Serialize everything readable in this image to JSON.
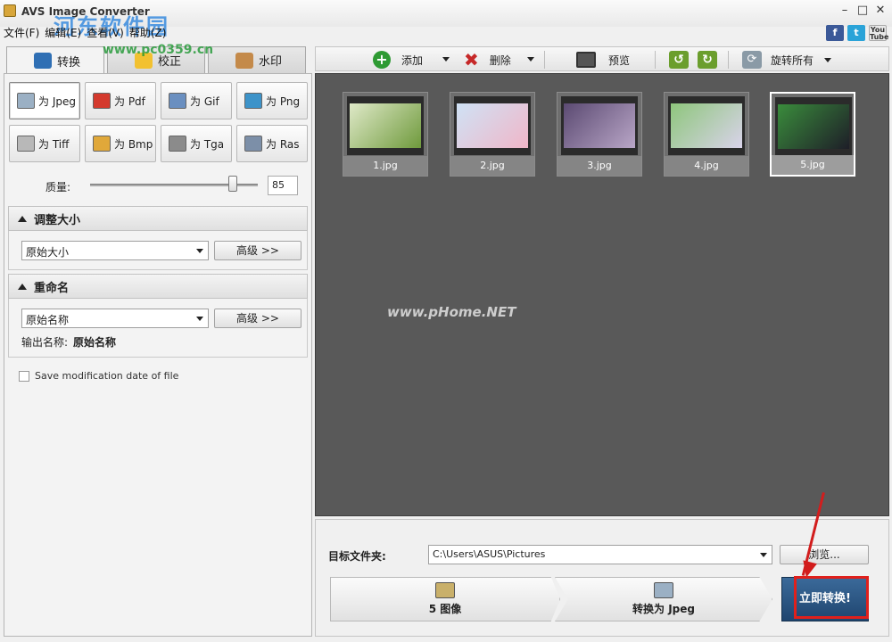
{
  "window": {
    "title": "AVS Image Converter",
    "watermark_logo": "河东软件园",
    "watermark_site": "www.pc0359.cn",
    "menu": [
      "文件(F)",
      "编辑(E)",
      "查看(V)",
      "帮助(Z)"
    ],
    "social": {
      "facebook": "f",
      "twitter": "t",
      "youtube": "You Tube"
    }
  },
  "tabs": [
    {
      "label": "转换",
      "active": true
    },
    {
      "label": "校正",
      "active": false
    },
    {
      "label": "水印",
      "active": false
    }
  ],
  "formats": [
    {
      "label": "为 Jpeg",
      "icon": "camera-icon",
      "selected": true
    },
    {
      "label": "为 Pdf",
      "icon": "pdf-icon",
      "selected": false
    },
    {
      "label": "为 Gif",
      "icon": "gif-icon",
      "selected": false
    },
    {
      "label": "为 Png",
      "icon": "monitor-icon",
      "selected": false
    },
    {
      "label": "为 Tiff",
      "icon": "printer-icon",
      "selected": false
    },
    {
      "label": "为 Bmp",
      "icon": "palette-icon",
      "selected": false
    },
    {
      "label": "为 Tga",
      "icon": "camera-icon",
      "selected": false
    },
    {
      "label": "为 Ras",
      "icon": "gear-icon",
      "selected": false
    }
  ],
  "quality": {
    "label": "质量:",
    "value": "85",
    "slider_fraction": 0.85
  },
  "resize": {
    "title": "调整大小",
    "combo_value": "原始大小",
    "advanced_label": "高级 >>"
  },
  "rename": {
    "title": "重命名",
    "combo_value": "原始名称",
    "advanced_label": "高级 >>",
    "output_label": "输出名称:",
    "output_value": "原始名称"
  },
  "save_date": {
    "label": "Save modification date of file",
    "checked": false
  },
  "toolbar": {
    "add": "添加",
    "delete": "删除",
    "preview": "预览",
    "rotate_all": "旋转所有"
  },
  "images": [
    {
      "name": "1.jpg",
      "selected": false,
      "colors": [
        "#dfe9c8",
        "#6f9a3c"
      ]
    },
    {
      "name": "2.jpg",
      "selected": false,
      "colors": [
        "#cfe2f5",
        "#f0b6c8"
      ]
    },
    {
      "name": "3.jpg",
      "selected": false,
      "colors": [
        "#5b4a72",
        "#b9a6c7"
      ]
    },
    {
      "name": "4.jpg",
      "selected": false,
      "colors": [
        "#8ec67c",
        "#d9d3ea"
      ]
    },
    {
      "name": "5.jpg",
      "selected": true,
      "colors": [
        "#3a8c3c",
        "#1e1e28"
      ]
    }
  ],
  "area_watermark": "www.pHome.NET",
  "destination": {
    "label": "目标文件夹:",
    "path": "C:\\Users\\ASUS\\Pictures",
    "browse_label": "浏览..."
  },
  "steps": {
    "count_label": "5 图像",
    "format_label": "转换为 Jpeg",
    "convert_label": "立即转换!"
  },
  "colors": {
    "accent": "#1f456f",
    "highlight": "#e0201c",
    "image_bg": "#595959"
  }
}
